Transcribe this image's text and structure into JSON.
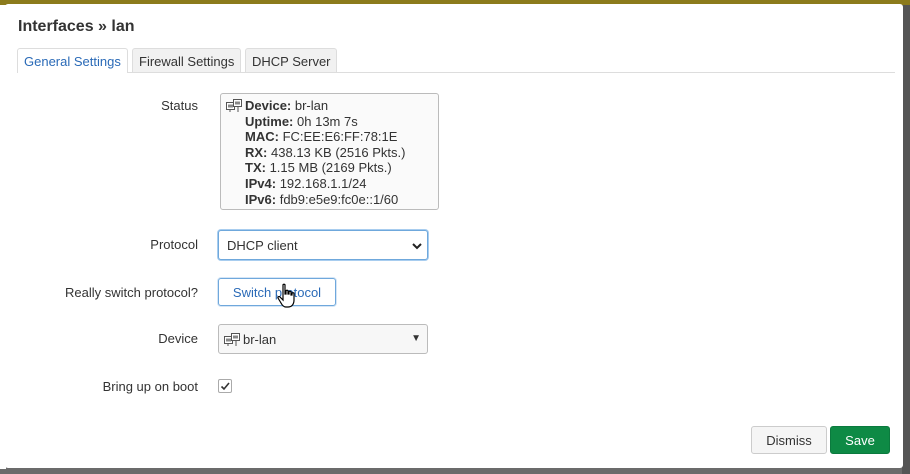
{
  "modal": {
    "title": "Interfaces » lan"
  },
  "tabs": [
    {
      "label": "General Settings",
      "active": true
    },
    {
      "label": "Firewall Settings",
      "active": false
    },
    {
      "label": "DHCP Server",
      "active": false
    }
  ],
  "status": {
    "label": "Status",
    "icon": "ethernet-bridge-icon",
    "lines": [
      {
        "key": "Device:",
        "value": "br-lan"
      },
      {
        "key": "Uptime:",
        "value": "0h 13m 7s"
      },
      {
        "key": "MAC:",
        "value": "FC:EE:E6:FF:78:1E"
      },
      {
        "key": "RX:",
        "value": "438.13 KB (2516 Pkts.)"
      },
      {
        "key": "TX:",
        "value": "1.15 MB (2169 Pkts.)"
      },
      {
        "key": "IPv4:",
        "value": "192.168.1.1/24"
      },
      {
        "key": "IPv6:",
        "value": "fdb9:e5e9:fc0e::1/60"
      }
    ]
  },
  "protocol": {
    "label": "Protocol",
    "selected": "DHCP client"
  },
  "switch_protocol": {
    "label": "Really switch protocol?",
    "button": "Switch protocol"
  },
  "device": {
    "label": "Device",
    "selected": "br-lan",
    "icon": "ethernet-bridge-icon"
  },
  "boot": {
    "label": "Bring up on boot",
    "checked": true
  },
  "footer": {
    "dismiss": "Dismiss",
    "save": "Save"
  },
  "colors": {
    "accent": "#2a6ab7",
    "save": "#0e8a45"
  }
}
